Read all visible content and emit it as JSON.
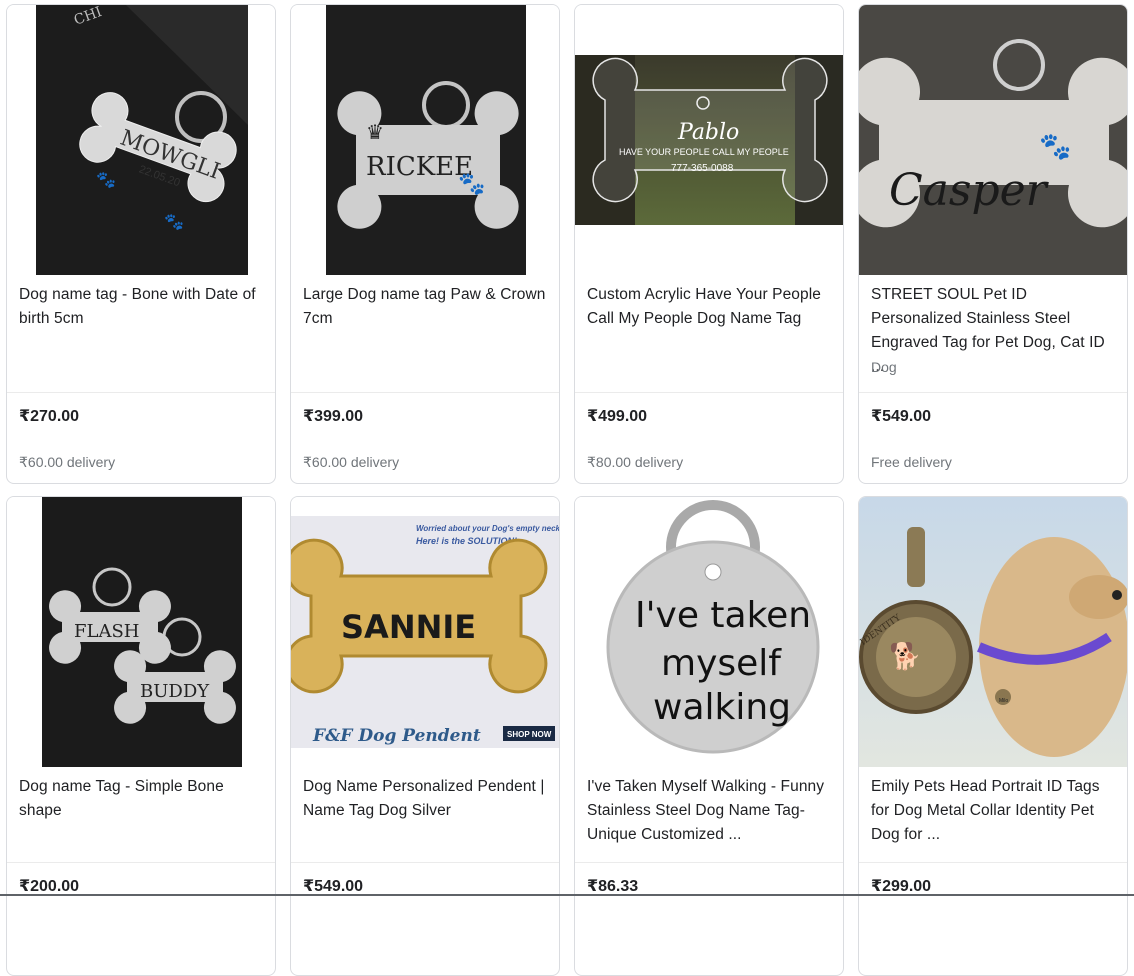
{
  "products": [
    {
      "title": "Dog name tag - Bone with Date of birth 5cm",
      "subtitle": "",
      "price": "₹270.00",
      "delivery": "₹60.00 delivery",
      "image": {
        "engraving": "MOWGLI",
        "date": "22.05.20"
      }
    },
    {
      "title": "Large Dog name tag Paw & Crown 7cm",
      "subtitle": "",
      "price": "₹399.00",
      "delivery": "₹60.00 delivery",
      "image": {
        "engraving": "RICKEE"
      }
    },
    {
      "title": "Custom Acrylic Have Your People Call My People Dog Name Tag",
      "subtitle": "",
      "price": "₹499.00",
      "delivery": "₹80.00 delivery",
      "image": {
        "engraving": "Pablo",
        "line1": "HAVE YOUR PEOPLE CALL MY PEOPLE",
        "line2": "777-365-0088"
      }
    },
    {
      "title": "STREET SOUL Pet ID Personalized Stainless Steel Engraved Tag for Pet Dog, Cat ID ...",
      "subtitle": "Dog",
      "price": "₹549.00",
      "delivery": "Free delivery",
      "image": {
        "engraving": "Casper"
      }
    },
    {
      "title": "Dog name Tag - Simple Bone shape",
      "subtitle": "",
      "price": "₹200.00",
      "delivery": "",
      "image": {
        "engraving1": "FLASH",
        "engraving2": "BUDDY"
      }
    },
    {
      "title": "Dog Name Personalized Pendent | Name Tag Dog Silver",
      "subtitle": "",
      "price": "₹549.00",
      "delivery": "",
      "image": {
        "engraving": "SANNIE",
        "banner1": "Worried about your Dog's empty neck?",
        "banner2": "Here! is the SOLUTION!",
        "brand": "F&F Dog Pendent",
        "cta": "SHOP NOW"
      }
    },
    {
      "title": "I've Taken Myself Walking - Funny Stainless Steel Dog Name Tag- Unique Customized ...",
      "subtitle": "",
      "price": "₹86.33",
      "delivery": "",
      "image": {
        "line1": "I've taken",
        "line2": "myself",
        "line3": "walking"
      }
    },
    {
      "title": "Emily Pets Head Portrait ID Tags for Dog Metal Collar Identity Pet Dog for ...",
      "subtitle": "",
      "price": "₹299.00",
      "delivery": "",
      "image": {
        "engraving": "IDENTITY",
        "tagname": "Milo"
      }
    }
  ]
}
